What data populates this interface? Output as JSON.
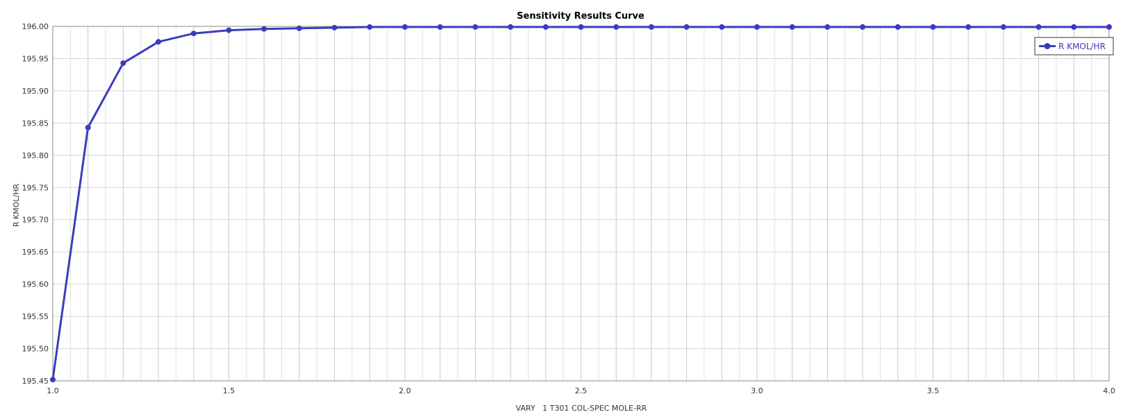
{
  "chart_data": {
    "type": "line",
    "title": "Sensitivity Results Curve",
    "xlabel": "VARY   1 T301 COL-SPEC MOLE-RR",
    "ylabel": "R KMOL/HR",
    "xlim": [
      1.0,
      4.0
    ],
    "ylim": [
      195.45,
      196.0
    ],
    "x_ticks": [
      "1.0",
      "1.5",
      "2.0",
      "2.5",
      "3.0",
      "3.5",
      "4.0"
    ],
    "y_ticks": [
      "196.00",
      "195.95",
      "195.90",
      "195.85",
      "195.80",
      "195.75",
      "195.70",
      "195.65",
      "195.60",
      "195.55",
      "195.50",
      "195.45"
    ],
    "grid": true,
    "legend_position": "top-right",
    "color": "#3b3bbf",
    "series": [
      {
        "name": "R KMOL/HR",
        "x": [
          1.0,
          1.1,
          1.2,
          1.3,
          1.4,
          1.5,
          1.6,
          1.7,
          1.8,
          1.9,
          2.0,
          2.1,
          2.2,
          2.3,
          2.4,
          2.5,
          2.6,
          2.7,
          2.8,
          2.9,
          3.0,
          3.1,
          3.2,
          3.3,
          3.4,
          3.5,
          3.6,
          3.7,
          3.8,
          3.9,
          4.0
        ],
        "y": [
          195.452,
          195.843,
          195.943,
          195.976,
          195.989,
          195.994,
          195.996,
          195.997,
          195.998,
          195.999,
          195.999,
          195.999,
          195.999,
          195.999,
          195.999,
          195.999,
          195.999,
          195.999,
          195.999,
          195.999,
          195.999,
          195.999,
          195.999,
          195.999,
          195.999,
          195.999,
          195.999,
          195.999,
          195.999,
          195.999,
          195.999
        ]
      }
    ]
  }
}
